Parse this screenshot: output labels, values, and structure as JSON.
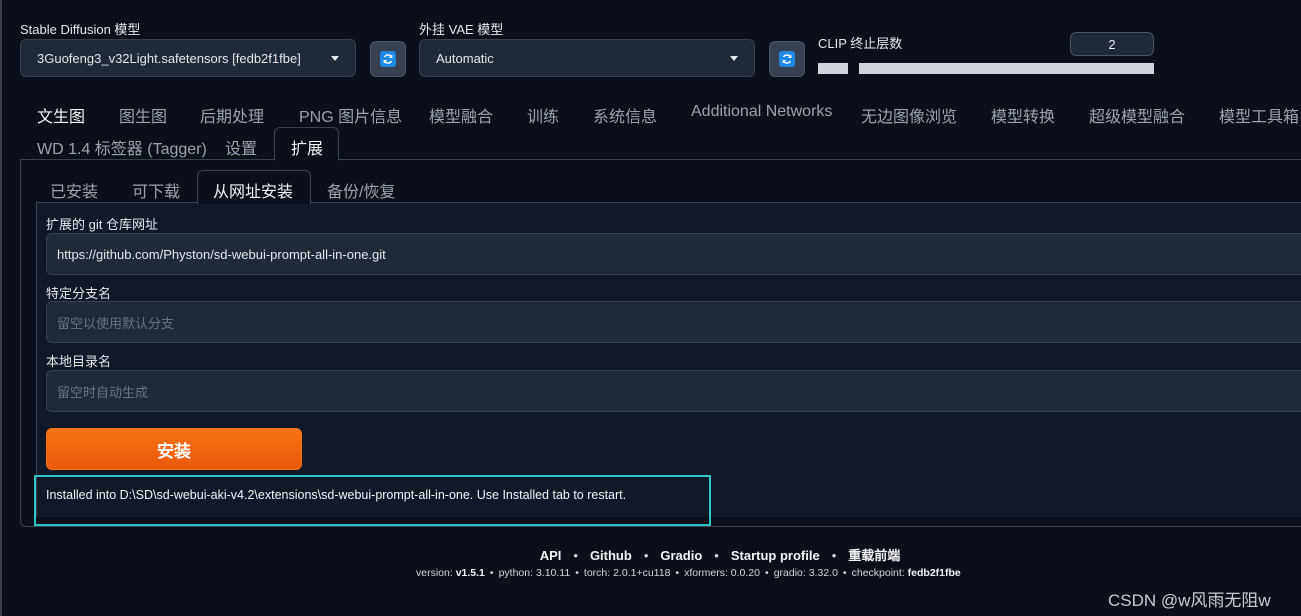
{
  "model": {
    "sd_label": "Stable Diffusion 模型",
    "sd_value": "3Guofeng3_v32Light.safetensors [fedb2f1fbe]",
    "vae_label": "外挂 VAE 模型",
    "vae_value": "Automatic",
    "clip_label": "CLIP 终止层数",
    "clip_value": "2"
  },
  "main_tabs": {
    "t0": "文生图",
    "t1": "图生图",
    "t2": "后期处理",
    "t3": "PNG 图片信息",
    "t4": "模型融合",
    "t5": "训练",
    "t6": "系统信息",
    "t7": "Additional Networks",
    "t8": "无边图像浏览",
    "t9": "模型转换",
    "t10": "超级模型融合",
    "t11": "模型工具箱",
    "t12": "WD 1.4 标签器 (Tagger)",
    "t13": "设置",
    "t14": "扩展"
  },
  "sub_tabs": {
    "s0": "已安装",
    "s1": "可下载",
    "s2": "从网址安装",
    "s3": "备份/恢复"
  },
  "form": {
    "git_label": "扩展的 git 仓库网址",
    "git_value": "https://github.com/Physton/sd-webui-prompt-all-in-one.git",
    "branch_label": "特定分支名",
    "branch_placeholder": "留空以使用默认分支",
    "dir_label": "本地目录名",
    "dir_placeholder": "留空时自动生成",
    "install_label": "安装",
    "result": "Installed into D:\\SD\\sd-webui-aki-v4.2\\extensions\\sd-webui-prompt-all-in-one. Use Installed tab to restart."
  },
  "footer": {
    "api": "API",
    "github": "Github",
    "gradio": "Gradio",
    "startup": "Startup profile",
    "reload": "重载前端",
    "version_label": "version:",
    "version": "v1.5.1",
    "python_label": "python:",
    "python": "3.10.11",
    "torch_label": "torch:",
    "torch": "2.0.1+cu118",
    "xformers_label": "xformers:",
    "xformers": "0.0.20",
    "gradio_label": "gradio:",
    "gradio_v": "3.32.0",
    "checkpoint_label": "checkpoint:",
    "checkpoint": "fedb2f1fbe"
  },
  "watermark": "CSDN @w风雨无阻w",
  "colors": {
    "background": "#0b0f19",
    "accent_orange": "#f97316",
    "highlight_cyan": "#2ec4c9",
    "refresh_blue": "#1e88e5"
  },
  "icons": {
    "refresh": "refresh-icon",
    "dropdown": "chevron-down-icon"
  }
}
